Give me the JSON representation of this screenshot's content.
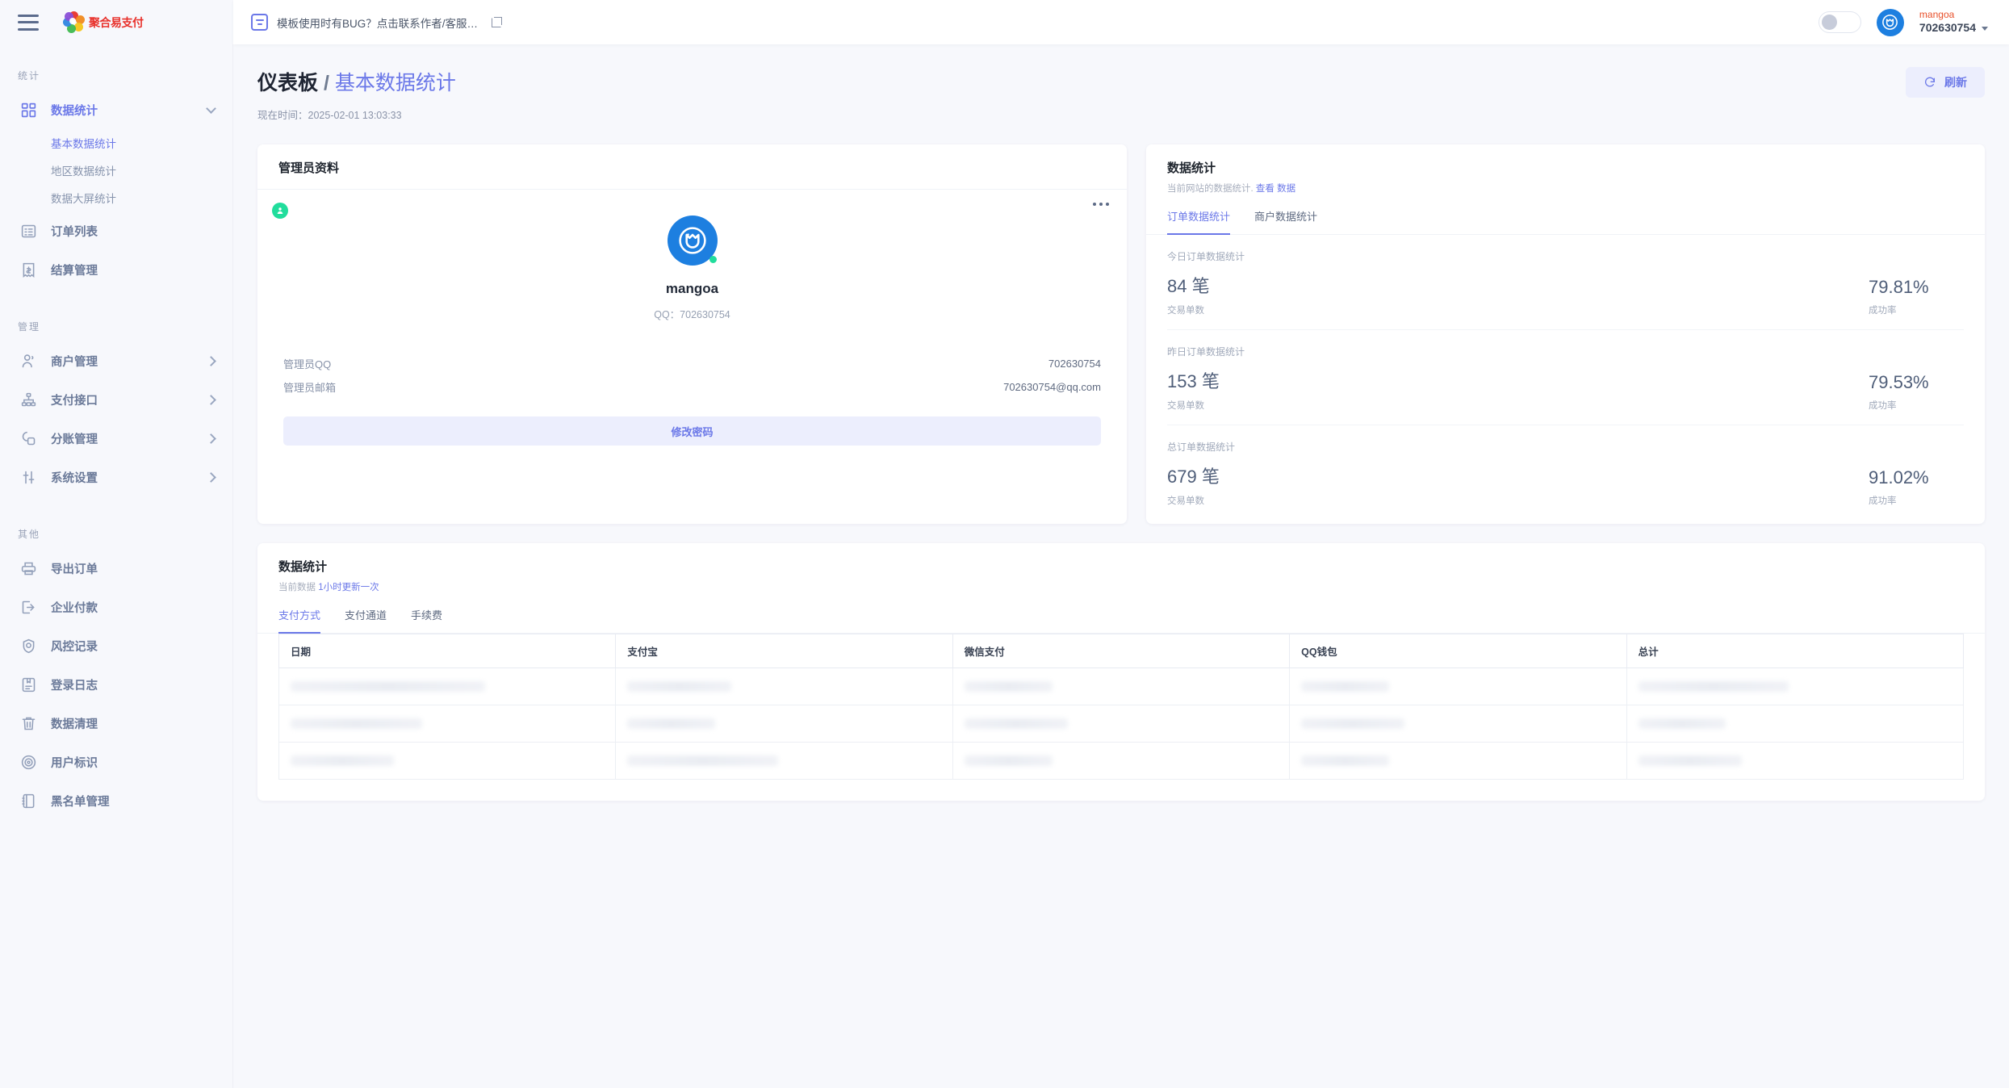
{
  "brand": {
    "logo_text": "聚合易支付"
  },
  "topbar": {
    "notice_text": "模板使用时有BUG？点击联系作者/客服…",
    "user_name": "mangoa",
    "user_id": "702630754"
  },
  "sidebar": {
    "groups": [
      {
        "title": "统计",
        "items": [
          {
            "label": "数据统计",
            "icon": "grid-icon",
            "expandable": true,
            "expanded": true,
            "active": true,
            "children": [
              {
                "label": "基本数据统计",
                "active": true
              },
              {
                "label": "地区数据统计",
                "active": false
              },
              {
                "label": "数据大屏统计",
                "active": false
              }
            ]
          },
          {
            "label": "订单列表",
            "icon": "list-icon",
            "expandable": false
          },
          {
            "label": "结算管理",
            "icon": "receipt-icon",
            "expandable": false
          }
        ]
      },
      {
        "title": "管理",
        "items": [
          {
            "label": "商户管理",
            "icon": "user-icon",
            "expandable": true
          },
          {
            "label": "支付接口",
            "icon": "sitemap-icon",
            "expandable": true
          },
          {
            "label": "分账管理",
            "icon": "shapes-icon",
            "expandable": true
          },
          {
            "label": "系统设置",
            "icon": "sliders-icon",
            "expandable": true
          }
        ]
      },
      {
        "title": "其他",
        "items": [
          {
            "label": "导出订单",
            "icon": "printer-icon",
            "expandable": false
          },
          {
            "label": "企业付款",
            "icon": "export-icon",
            "expandable": false
          },
          {
            "label": "风控记录",
            "icon": "shield-icon",
            "expandable": false
          },
          {
            "label": "登录日志",
            "icon": "book-icon",
            "expandable": false
          },
          {
            "label": "数据清理",
            "icon": "trash-icon",
            "expandable": false
          },
          {
            "label": "用户标识",
            "icon": "target-icon",
            "expandable": false
          },
          {
            "label": "黑名单管理",
            "icon": "address-book-icon",
            "expandable": false
          }
        ]
      }
    ]
  },
  "page": {
    "title_main": "仪表板",
    "title_sep": "/",
    "title_sub": "基本数据统计",
    "time_label": "现在时间：",
    "time_value": "2025-02-01 13:03:33",
    "refresh_label": "刷新"
  },
  "profile_card": {
    "title": "管理员资料",
    "avatar_name": "mangoa",
    "avatar_qq": "QQ：702630754",
    "rows": [
      {
        "key": "管理员QQ",
        "value": "702630754"
      },
      {
        "key": "管理员邮箱",
        "value": "702630754@qq.com"
      }
    ],
    "button_label": "修改密码"
  },
  "stats_card": {
    "title": "数据统计",
    "sub_prefix": "当前网站的数据统计.",
    "sub_link": "查看 数据",
    "tabs": [
      {
        "label": "订单数据统计",
        "active": true
      },
      {
        "label": "商户数据统计",
        "active": false
      }
    ],
    "blocks": [
      {
        "caption": "今日订单数据统计",
        "count": "84 笔",
        "count_label": "交易单数",
        "rate": "79.81%",
        "rate_label": "成功率"
      },
      {
        "caption": "昨日订单数据统计",
        "count": "153 笔",
        "count_label": "交易单数",
        "rate": "79.53%",
        "rate_label": "成功率"
      },
      {
        "caption": "总订单数据统计",
        "count": "679 笔",
        "count_label": "交易单数",
        "rate": "91.02%",
        "rate_label": "成功率"
      }
    ]
  },
  "bottom_card": {
    "title": "数据统计",
    "sub_prefix": "当前数据",
    "sub_link": "1小时更新一次",
    "tabs": [
      {
        "label": "支付方式",
        "active": true
      },
      {
        "label": "支付通道",
        "active": false
      },
      {
        "label": "手续费",
        "active": false
      }
    ],
    "table": {
      "columns": [
        "日期",
        "支付宝",
        "微信支付",
        "QQ钱包",
        "总计"
      ],
      "rows": [
        [
          "",
          "",
          "",
          "",
          ""
        ],
        [
          "",
          "",
          "",
          "",
          ""
        ],
        [
          "",
          "",
          "",
          "",
          ""
        ]
      ]
    }
  },
  "colors": {
    "accent": "#6b78e8",
    "brand_red": "#e8302a",
    "avatar_blue": "#1d7fe0",
    "online_green": "#21dd9c",
    "page_bg": "#f7f8fc"
  }
}
